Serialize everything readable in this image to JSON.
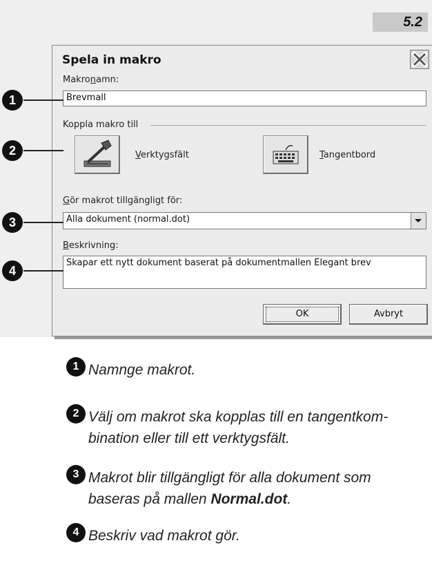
{
  "section_number": "5.2",
  "dialog": {
    "title": "Spela in makro",
    "macro_name_label_pre": "Makro",
    "macro_name_label_u": "n",
    "macro_name_label_post": "amn:",
    "macro_name_value": "Brevmall",
    "assign_group_label": "Koppla makro till",
    "toolbar_button_label_u": "V",
    "toolbar_button_label_rest": "erktygsfält",
    "keyboard_button_label_u": "T",
    "keyboard_button_label_rest": "angentbord",
    "store_label_u": "G",
    "store_label_rest": "ör makrot tillgängligt för:",
    "store_value": "Alla dokument (normal.dot)",
    "description_label_u": "B",
    "description_label_rest": "eskrivning:",
    "description_value": "Skapar ett nytt dokument baserat på dokumentmallen Elegant brev",
    "ok_label": "OK",
    "cancel_label": "Avbryt"
  },
  "callouts": [
    "1",
    "2",
    "3",
    "4"
  ],
  "notes": [
    {
      "num": "1",
      "text": "Namnge makrot."
    },
    {
      "num": "2",
      "text": " Välj om makrot ska kopplas till en tangentkom-",
      "text2": "bination eller till ett verktygsfält."
    },
    {
      "num": "3",
      "text": "Makrot blir tillgängligt för alla dokument som",
      "text2_pre": "baseras på mallen ",
      "text2_bold": "Normal.dot",
      "text2_post": "."
    },
    {
      "num": "4",
      "text": "Beskriv vad makrot gör."
    }
  ],
  "icons": {
    "close": "close-icon",
    "toolbar": "hammer-toolbar-icon",
    "keyboard": "keyboard-icon",
    "dropdown": "chevron-down-icon"
  }
}
